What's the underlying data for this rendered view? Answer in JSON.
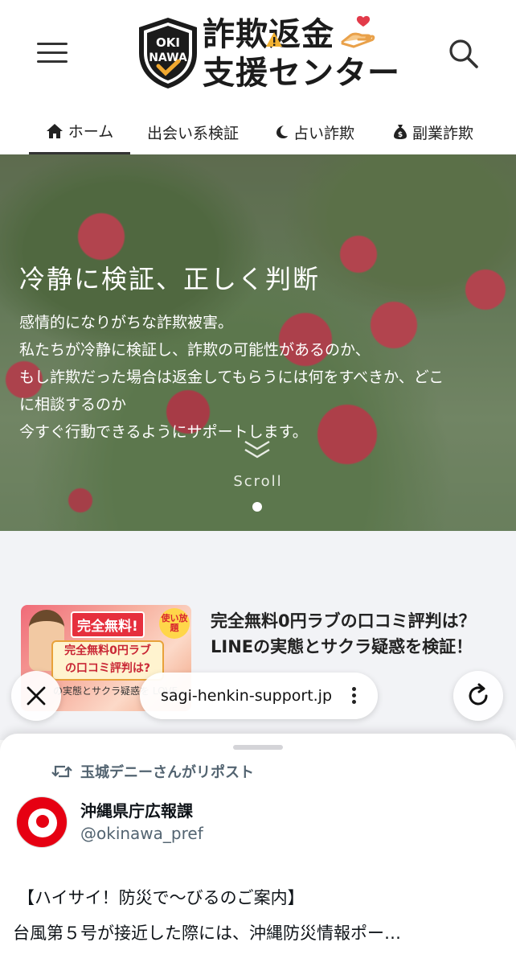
{
  "header": {
    "menu_icon": "hamburger-menu-icon",
    "logo": {
      "badge_top": "OKI",
      "badge_bottom": "NAWA",
      "line1": "詐欺返金",
      "line2": "支援センター"
    },
    "search_icon": "search-icon"
  },
  "nav": {
    "tabs": [
      {
        "label": "ホーム",
        "icon": "home-icon",
        "active": true
      },
      {
        "label": "出会い系検証",
        "icon": "",
        "active": false
      },
      {
        "label": "占い詐欺",
        "icon": "moon-icon",
        "active": false
      },
      {
        "label": "副業詐欺",
        "icon": "money-bag-icon",
        "active": false
      }
    ]
  },
  "hero": {
    "title": "冷静に検証、正しく判断",
    "lines": [
      "感情的になりがちな詐欺被害。",
      "私たちが冷静に検証し、詐欺の可能性があるのか、",
      "もし詐欺だった場合は返金してもらうには何をすべきか、どこ",
      "に相談するのか",
      "今すぐ行動できるようにサポートします。"
    ],
    "scroll_label": "Scroll",
    "slide_count": 1
  },
  "article": {
    "thumb": {
      "badge": "完全無料!",
      "badge2": "使い放題",
      "box_line1": "完全無料0円ラブ",
      "box_line2": "の口コミ評判は?",
      "bottom": "の実態とサクラ疑惑を LOVE"
    },
    "title": "完全無料0円ラブの口コミ評判は？LINEの実態とサクラ疑惑を検証！"
  },
  "browser": {
    "url": "sagi-henkin-support.jp",
    "close_icon": "close-icon",
    "more_icon": "more-vertical-icon",
    "reload_icon": "reload-icon"
  },
  "sheet": {
    "repost_label": "玉城デニーさんがリポスト",
    "account_name": "沖縄県庁広報課",
    "account_handle": "@okinawa_pref",
    "post_line1": "【ハイサイ！防災で〜びるのご案内】",
    "post_line2": "台風第５号が接近した際には、沖縄防災情報ポー…"
  },
  "colors": {
    "accent_red": "#e60012",
    "text_dark": "#222222",
    "text_muted": "#536471"
  }
}
